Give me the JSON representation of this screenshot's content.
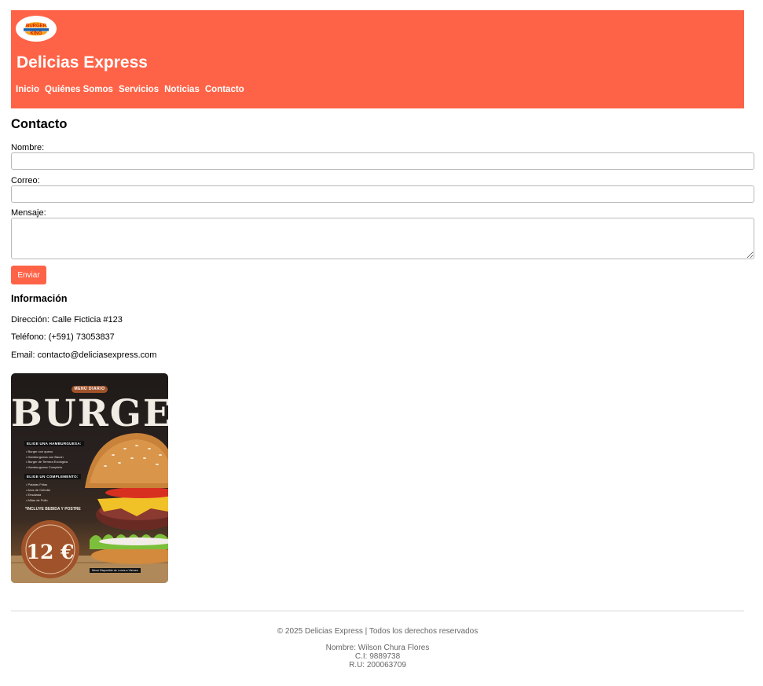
{
  "header": {
    "logo_text": "BURGER KING",
    "site_title": "Delicias Express",
    "nav": [
      "Inicio",
      "Quiénes Somos",
      "Servicios",
      "Noticias",
      "Contacto"
    ],
    "colors": {
      "accent": "#ff6347",
      "header_text": "#ffffff"
    }
  },
  "contact": {
    "title": "Contacto",
    "fields": {
      "name_label": "Nombre:",
      "name_value": "",
      "email_label": "Correo:",
      "email_value": "",
      "message_label": "Mensaje:",
      "message_value": ""
    },
    "submit_label": "Enviar"
  },
  "info": {
    "title": "Información",
    "address": "Dirección: Calle Ficticia #123",
    "phone": "Teléfono: (+591) 73053837",
    "email": "Email: contacto@deliciasexpress.com"
  },
  "poster": {
    "tag": "MENÚ DIARIO",
    "title": "BURGER",
    "section1": "ELIGE UNA HAMBURGUESA:",
    "items1": [
      "Burger con queso",
      "Hamburguesa con Bacon",
      "Burger de Ternera Ecológica",
      "Hamburguesa Completa"
    ],
    "section2": "ELIGE UN COMPLEMENTO:",
    "items2": [
      "Patatas Fritas",
      "Aros de Cebolla",
      "Ensalada",
      "Alitas de Pollo"
    ],
    "note": "*INCLUYE BEBIDA Y POSTRE",
    "price": "12 €",
    "footnote": "Menú Disponible de Lunes a Viernes"
  },
  "footer": {
    "copyright": "© 2025 Delicias Express | Todos los derechos reservados",
    "author": "Nombre: Wilson Chura Flores",
    "ci": "C.I: 9889738",
    "ru": "R.U: 200063709"
  }
}
